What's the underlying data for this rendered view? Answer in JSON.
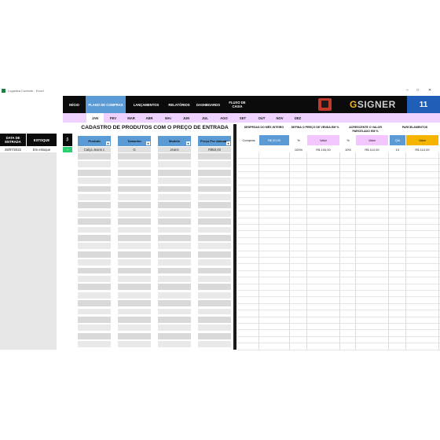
{
  "window": {
    "title": "Logística Controle - Excel"
  },
  "nav": {
    "items": [
      "INÍCIO",
      "PLANO DE COMPRAS",
      "LANÇAMENTOS",
      "RELATÓRIOS",
      "DASHBOARDS",
      "FLUXO DE CAIXA"
    ],
    "active_index": 1,
    "logo_text": "SIGNER",
    "counter": "11"
  },
  "months": {
    "items": [
      "JAN",
      "FEV",
      "MAR",
      "ABR",
      "MAI",
      "JUN",
      "JUL",
      "AGO",
      "SET",
      "OUT",
      "NOV",
      "DEZ"
    ],
    "active_index": 0
  },
  "side": {
    "headers": [
      "DATA DE ENTRADA",
      "ESTOQUE"
    ],
    "row": {
      "date": "28/07/2022",
      "stock": "Em estoque"
    }
  },
  "main": {
    "b_button": "β",
    "title": "CADASTRO DE PRODUTOS COM O PREÇO DE ENTRADA",
    "columns": [
      "Produto",
      "Tamanho",
      "Modelo",
      "Preço Por Atacado"
    ],
    "row": [
      "Calça Jeans c",
      "G",
      "Jeans",
      "R$50,00"
    ]
  },
  "right": {
    "sections": [
      "DESPESAS DO MÊS INTEIRO",
      "DEFINA O PREÇO DE VENDA EM %",
      "ACRESCENTE O VALOR PARCELADO EM %",
      "PARCELAMENTOS"
    ],
    "sub_headers": [
      "Compras",
      "R$ 50,00",
      "%",
      "Valor",
      "%",
      "Valor",
      "Qtd",
      "Valor"
    ],
    "row": [
      "",
      "",
      "100%",
      "R$ 100,00",
      "10%",
      "R$ 110,00",
      "1X",
      "R$ 110,00"
    ],
    "colors": {
      "blue": "#5b9bd5",
      "pink": "#f3c6ff",
      "gold": "#f5b400"
    }
  }
}
